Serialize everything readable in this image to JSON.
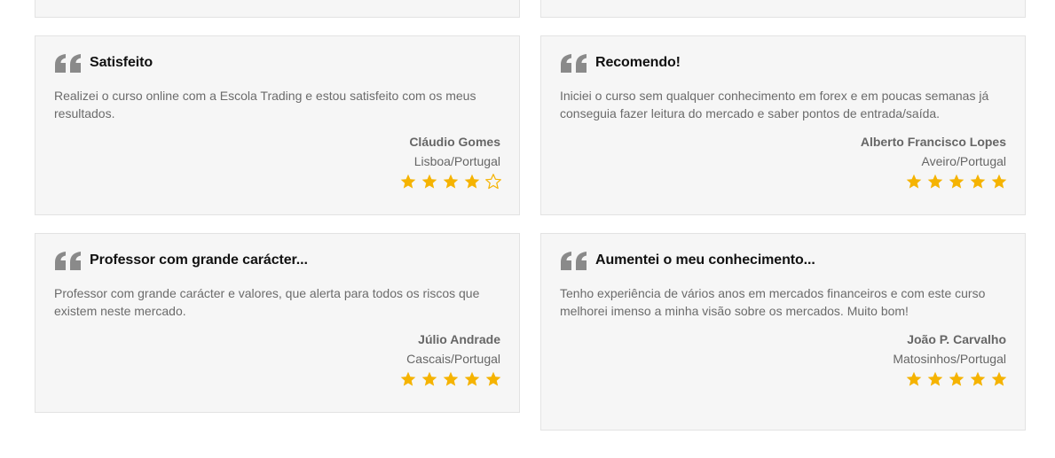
{
  "colors": {
    "card_background": "#f6f6f6",
    "card_border": "#e3e3e3",
    "star": "#f5b301",
    "quote_icon": "#8a8a8a",
    "title": "#111111",
    "text": "#6b6b6b"
  },
  "testimonials": [
    {
      "title": "Satisfeito",
      "text": "Realizei o curso online com a Escola Trading e estou satisfeito com os meus resultados.",
      "author": "Cláudio Gomes",
      "location": "Lisboa/Portugal",
      "rating": 4,
      "max_rating": 5
    },
    {
      "title": "Recomendo!",
      "text": "Iniciei o curso sem qualquer conhecimento em forex e em poucas semanas já conseguia fazer leitura do mercado e saber pontos de entrada/saída.",
      "author": "Alberto Francisco Lopes",
      "location": "Aveiro/Portugal",
      "rating": 5,
      "max_rating": 5
    },
    {
      "title": "Professor com grande carácter...",
      "text": "Professor com grande carácter e valores, que alerta para todos os riscos que existem neste mercado.",
      "author": "Júlio Andrade",
      "location": "Cascais/Portugal",
      "rating": 5,
      "max_rating": 5
    },
    {
      "title": "Aumentei o meu conhecimento...",
      "text": "Tenho experiência de vários anos em mercados financeiros e com este curso melhorei imenso a minha visão sobre os mercados. Muito bom!",
      "author": "João P. Carvalho",
      "location": "Matosinhos/Portugal",
      "rating": 5,
      "max_rating": 5
    }
  ]
}
